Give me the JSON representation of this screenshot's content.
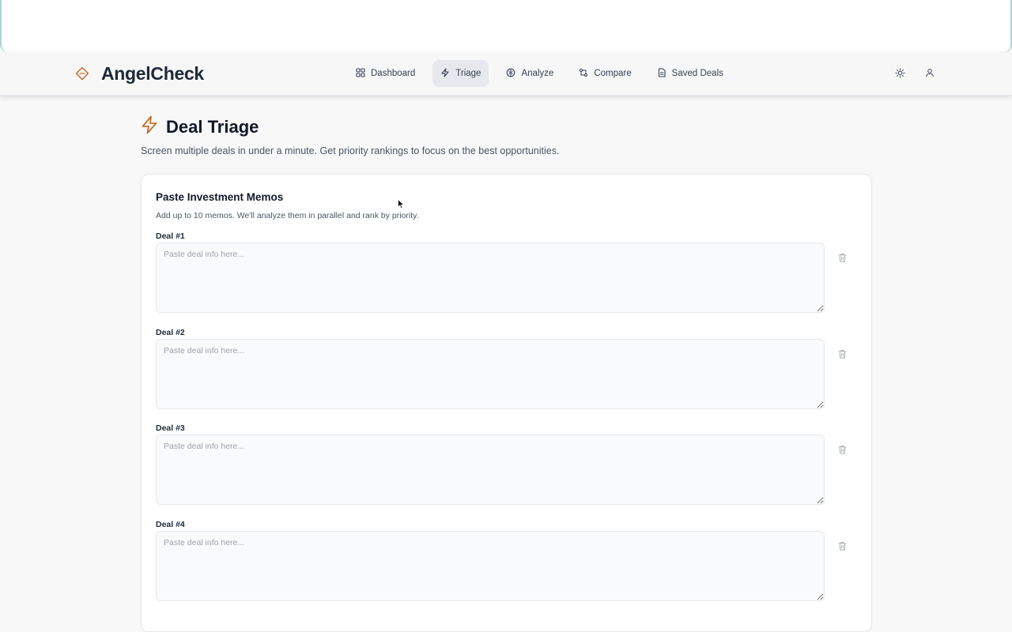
{
  "app": {
    "brand_name": "AngelCheck",
    "accent_color": "#c2712b"
  },
  "nav": {
    "items": [
      {
        "label": "Dashboard",
        "icon": "grid-icon",
        "active": false
      },
      {
        "label": "Triage",
        "icon": "lightning-icon",
        "active": true
      },
      {
        "label": "Analyze",
        "icon": "brain-icon",
        "active": false
      },
      {
        "label": "Compare",
        "icon": "compare-arrows-icon",
        "active": false
      },
      {
        "label": "Saved Deals",
        "icon": "document-icon",
        "active": false
      }
    ],
    "right_icons": [
      "sun-icon",
      "user-icon"
    ]
  },
  "page": {
    "title": "Deal Triage",
    "subtitle": "Screen multiple deals in under a minute. Get priority rankings to focus on the best opportunities."
  },
  "memos_card": {
    "title": "Paste Investment Memos",
    "description": "Add up to 10 memos. We'll analyze them in parallel and rank by priority.",
    "deals": [
      {
        "label": "Deal #1",
        "placeholder": "Paste deal info here...",
        "value": ""
      },
      {
        "label": "Deal #2",
        "placeholder": "Paste deal info here...",
        "value": ""
      },
      {
        "label": "Deal #3",
        "placeholder": "Paste deal info here...",
        "value": ""
      },
      {
        "label": "Deal #4",
        "placeholder": "Paste deal info here...",
        "value": ""
      }
    ]
  }
}
